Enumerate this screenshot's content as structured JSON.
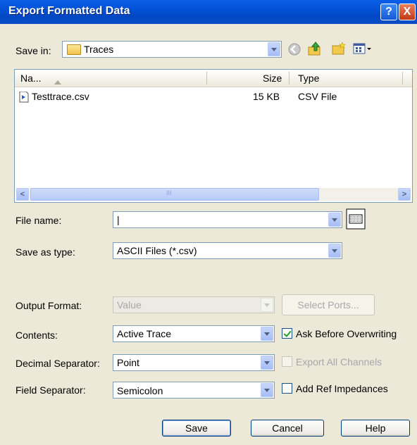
{
  "window": {
    "title": "Export Formatted Data",
    "help_glyph": "?",
    "close_glyph": "X"
  },
  "save_in": {
    "label": "Save in:",
    "value": "Traces"
  },
  "file_list": {
    "columns": [
      {
        "label": "Na..."
      },
      {
        "label": "Size"
      },
      {
        "label": "Type"
      }
    ],
    "rows": [
      {
        "name": "Testtrace.csv",
        "size": "15 KB",
        "type": "CSV File"
      }
    ],
    "scroll_left": "<",
    "scroll_right": ">",
    "thumb_grip": "III"
  },
  "file_name": {
    "label": "File name:",
    "value": "|"
  },
  "save_as_type": {
    "label": "Save as type:",
    "value": "ASCII Files (*.csv)"
  },
  "output_format": {
    "label": "Output Format:",
    "value": "Value",
    "select_ports_label": "Select Ports..."
  },
  "contents": {
    "label": "Contents:",
    "value": "Active Trace",
    "ask_overwrite_label": "Ask Before Overwriting",
    "ask_overwrite_checked": true
  },
  "decimal_separator": {
    "label": "Decimal Separator:",
    "value": "Point",
    "export_all_label": "Export All Channels",
    "export_all_checked": false
  },
  "field_separator": {
    "label": "Field Separator:",
    "value": "Semicolon",
    "add_ref_label": "Add Ref Impedances",
    "add_ref_checked": false
  },
  "buttons": {
    "save": "Save",
    "cancel": "Cancel",
    "help": "Help"
  }
}
